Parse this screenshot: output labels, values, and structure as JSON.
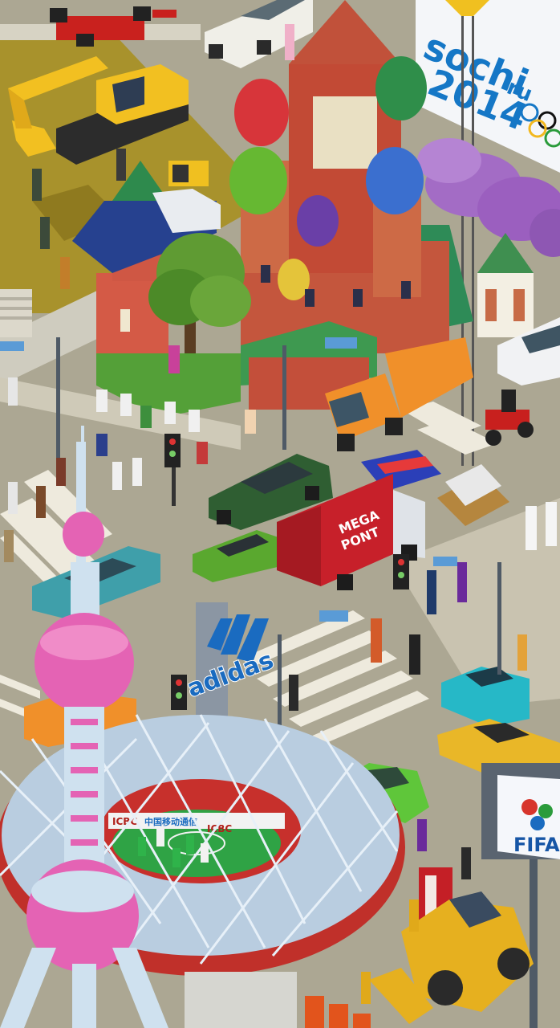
{
  "scene": {
    "sochi_line1": "sochi",
    "sochi_line2": "2014",
    "sochi_ru": "ru",
    "megapont_line1": "MEGA",
    "megapont_line2": "PONT",
    "adidas_label": "adidas",
    "fifa_label": "FIFA",
    "icbc_left": "ICBC",
    "icbc_right": "ICBC",
    "chinese_banner": "中国移动通信"
  },
  "colors": {
    "asphalt": "#aca793",
    "crosswalk": "#eeeadd",
    "dirt": "#a8922c",
    "grass": "#4d9c35",
    "stadium_steel": "#9fb9d3",
    "stadium_red": "#c0302a",
    "tower_pink": "#e463b4",
    "tower_light": "#cfe1ef",
    "sign_blue": "#1a6bc0",
    "truck_red": "#c7202a",
    "truck_orange": "#f0902a",
    "car_green_dark": "#2f5e32",
    "car_cyan": "#26b8c7",
    "car_yellow": "#e9b728",
    "car_teal": "#3f9faa",
    "car_lime": "#5fc63a"
  }
}
